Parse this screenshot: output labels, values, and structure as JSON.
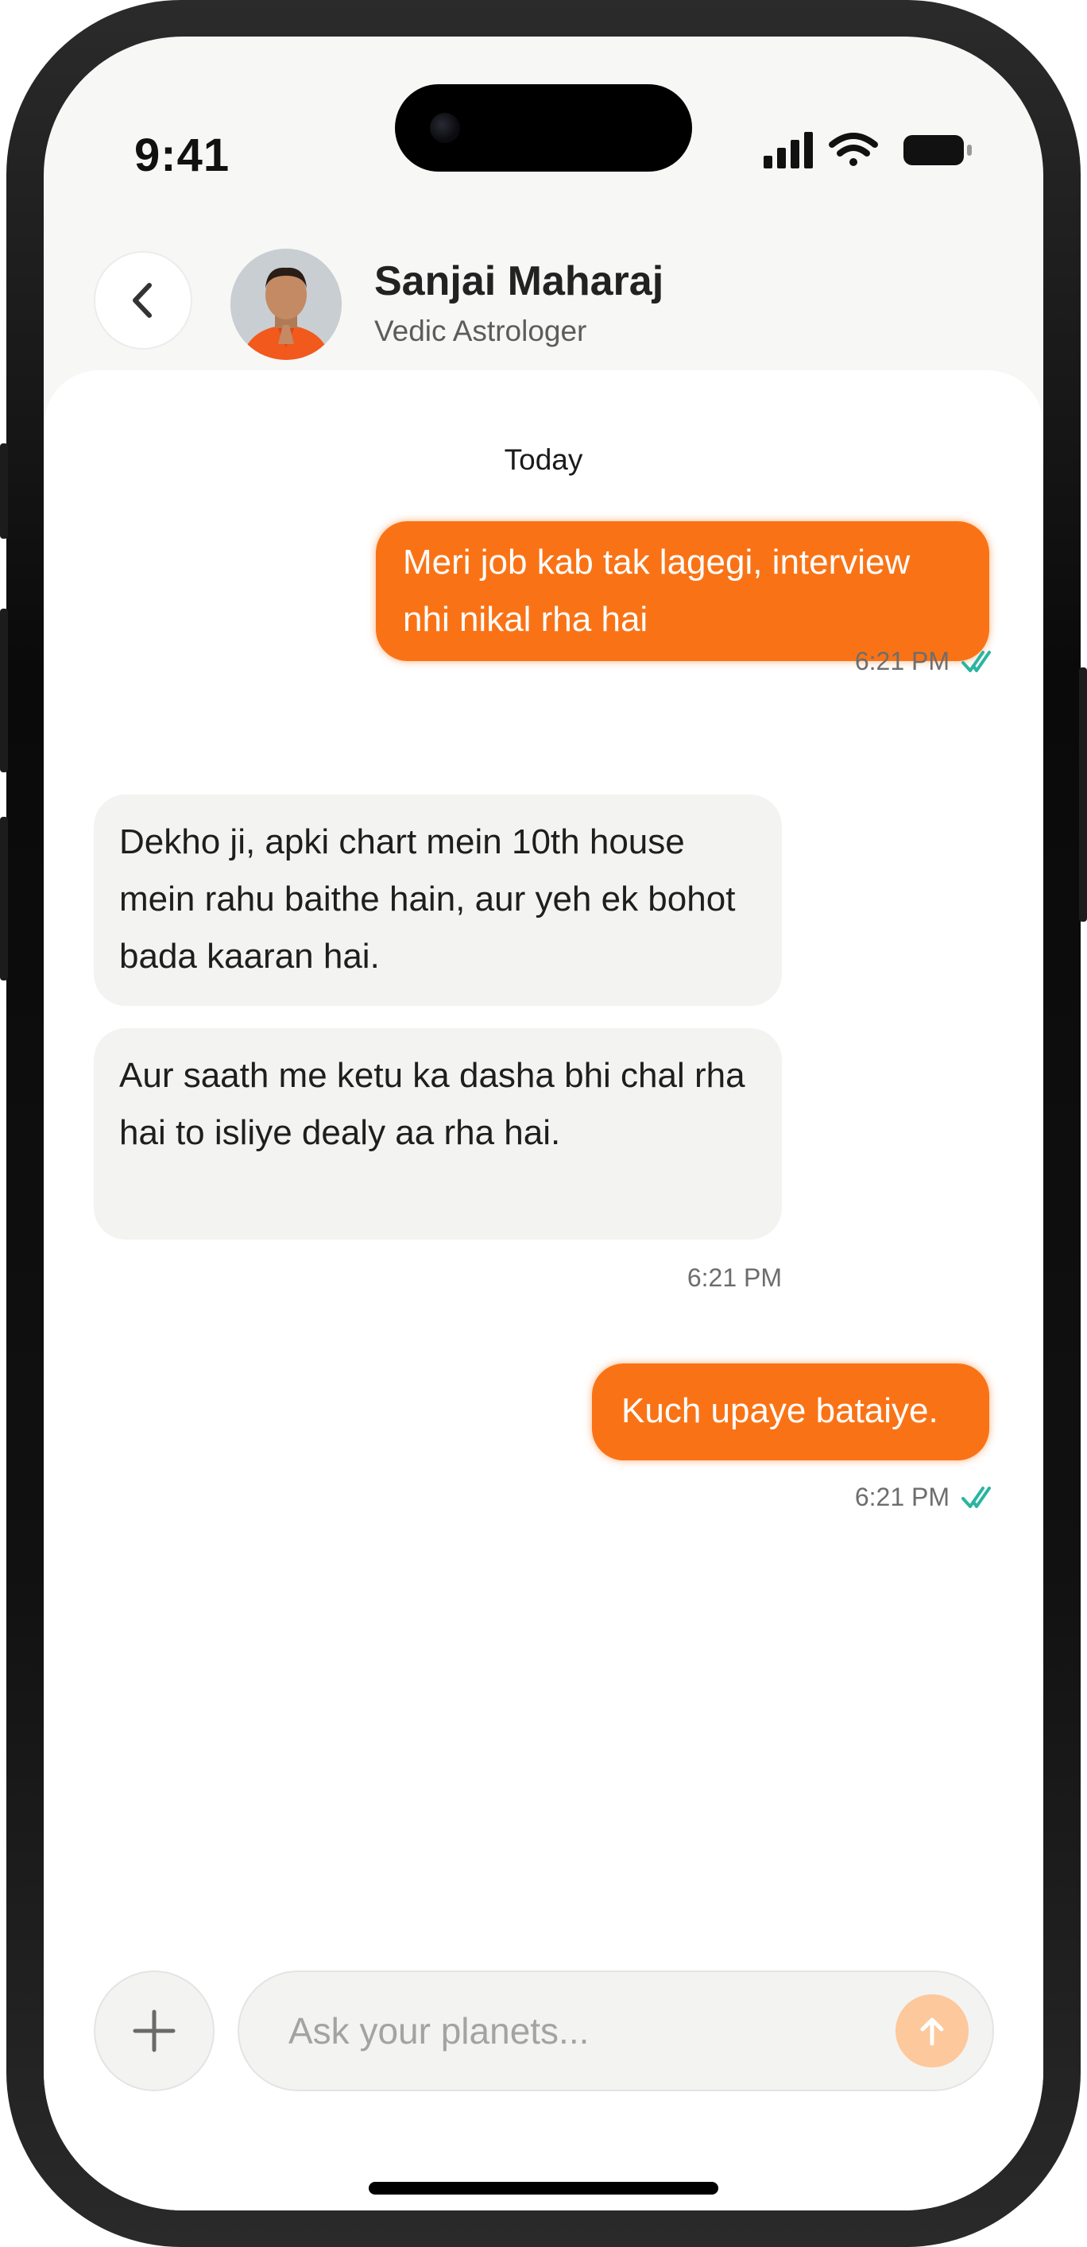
{
  "status_bar": {
    "time": "9:41"
  },
  "header": {
    "name": "Sanjai Maharaj",
    "role": "Vedic Astrologer"
  },
  "chat": {
    "date_label": "Today",
    "messages": [
      {
        "sender": "user",
        "text": "Meri job kab tak lagegi, interview nhi nikal rha hai",
        "time": "6:21 PM",
        "read": true
      },
      {
        "sender": "astrologer",
        "text": "Dekho ji, apki chart mein 10th house mein rahu baithe hain, aur yeh ek bohot bada kaaran hai."
      },
      {
        "sender": "astrologer",
        "text": "Aur saath me ketu ka dasha bhi chal rha hai to isliye dealy aa rha hai.",
        "time": "6:21 PM"
      },
      {
        "sender": "user",
        "text": "Kuch upaye bataiye.",
        "time": "6:21 PM",
        "read": true
      }
    ]
  },
  "composer": {
    "placeholder": "Ask your planets..."
  },
  "colors": {
    "accent": "#f97316",
    "read_tick": "#2bb5a0",
    "send_button": "#fdc89b"
  },
  "icons": [
    "back-chevron-icon",
    "plus-icon",
    "send-arrow-icon",
    "cellular-signal-icon",
    "wifi-icon",
    "battery-icon",
    "double-check-icon"
  ]
}
